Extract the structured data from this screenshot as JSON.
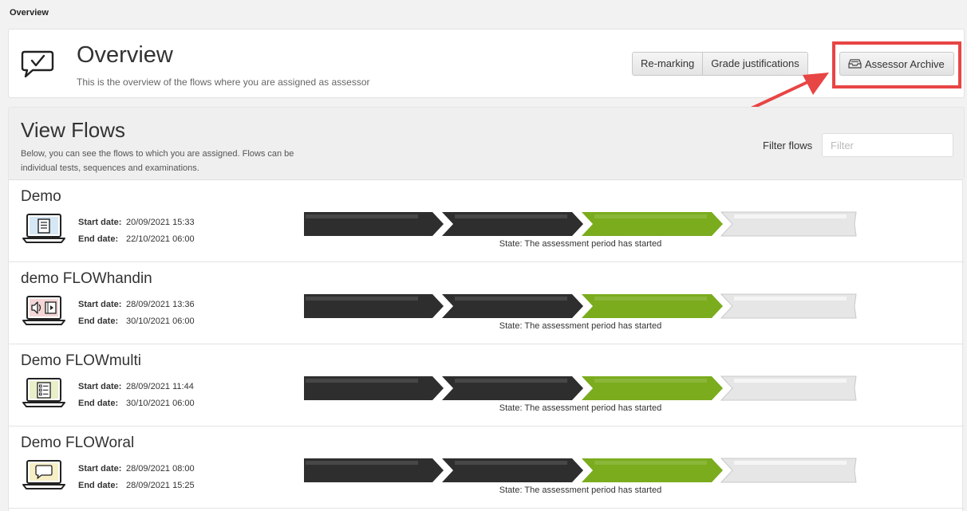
{
  "breadcrumb": "Overview",
  "header": {
    "title": "Overview",
    "subtitle": "This is the overview of the flows where you are assigned as assessor",
    "icon": "checkmark-speech-bubble-icon",
    "buttons": {
      "remarking": "Re-marking",
      "grade_justifications": "Grade justifications",
      "assessor_archive": "Assessor Archive"
    }
  },
  "annotation": {
    "highlight_color": "#e84545"
  },
  "view_flows": {
    "title": "View Flows",
    "description": "Below, you can see the flows to which you are assigned. Flows can be individual tests, sequences and examinations.",
    "filter_label": "Filter flows",
    "filter_placeholder": "Filter",
    "filter_value": ""
  },
  "labels": {
    "start_date": "Start date:",
    "end_date": "End date:"
  },
  "progress_colors": {
    "done": "#2e2e2e",
    "active": "#7aac1e",
    "pending": "#e6e6e6"
  },
  "flows": [
    {
      "name": "Demo",
      "icon": "laptop-document-icon",
      "start": "20/09/2021 15:33",
      "end": "22/10/2021 06:00",
      "state": "State: The assessment period has started",
      "stage": 3,
      "stages_total": 4
    },
    {
      "name": "demo FLOWhandin",
      "icon": "laptop-media-icon",
      "start": "28/09/2021 13:36",
      "end": "30/10/2021 06:00",
      "state": "State: The assessment period has started",
      "stage": 3,
      "stages_total": 4
    },
    {
      "name": "Demo FLOWmulti",
      "icon": "laptop-checklist-icon",
      "start": "28/09/2021 11:44",
      "end": "30/10/2021 06:00",
      "state": "State: The assessment period has started",
      "stage": 3,
      "stages_total": 4
    },
    {
      "name": "Demo FLOWoral",
      "icon": "laptop-speech-icon",
      "start": "28/09/2021 08:00",
      "end": "28/09/2021 15:25",
      "state": "State: The assessment period has started",
      "stage": 3,
      "stages_total": 4
    }
  ]
}
